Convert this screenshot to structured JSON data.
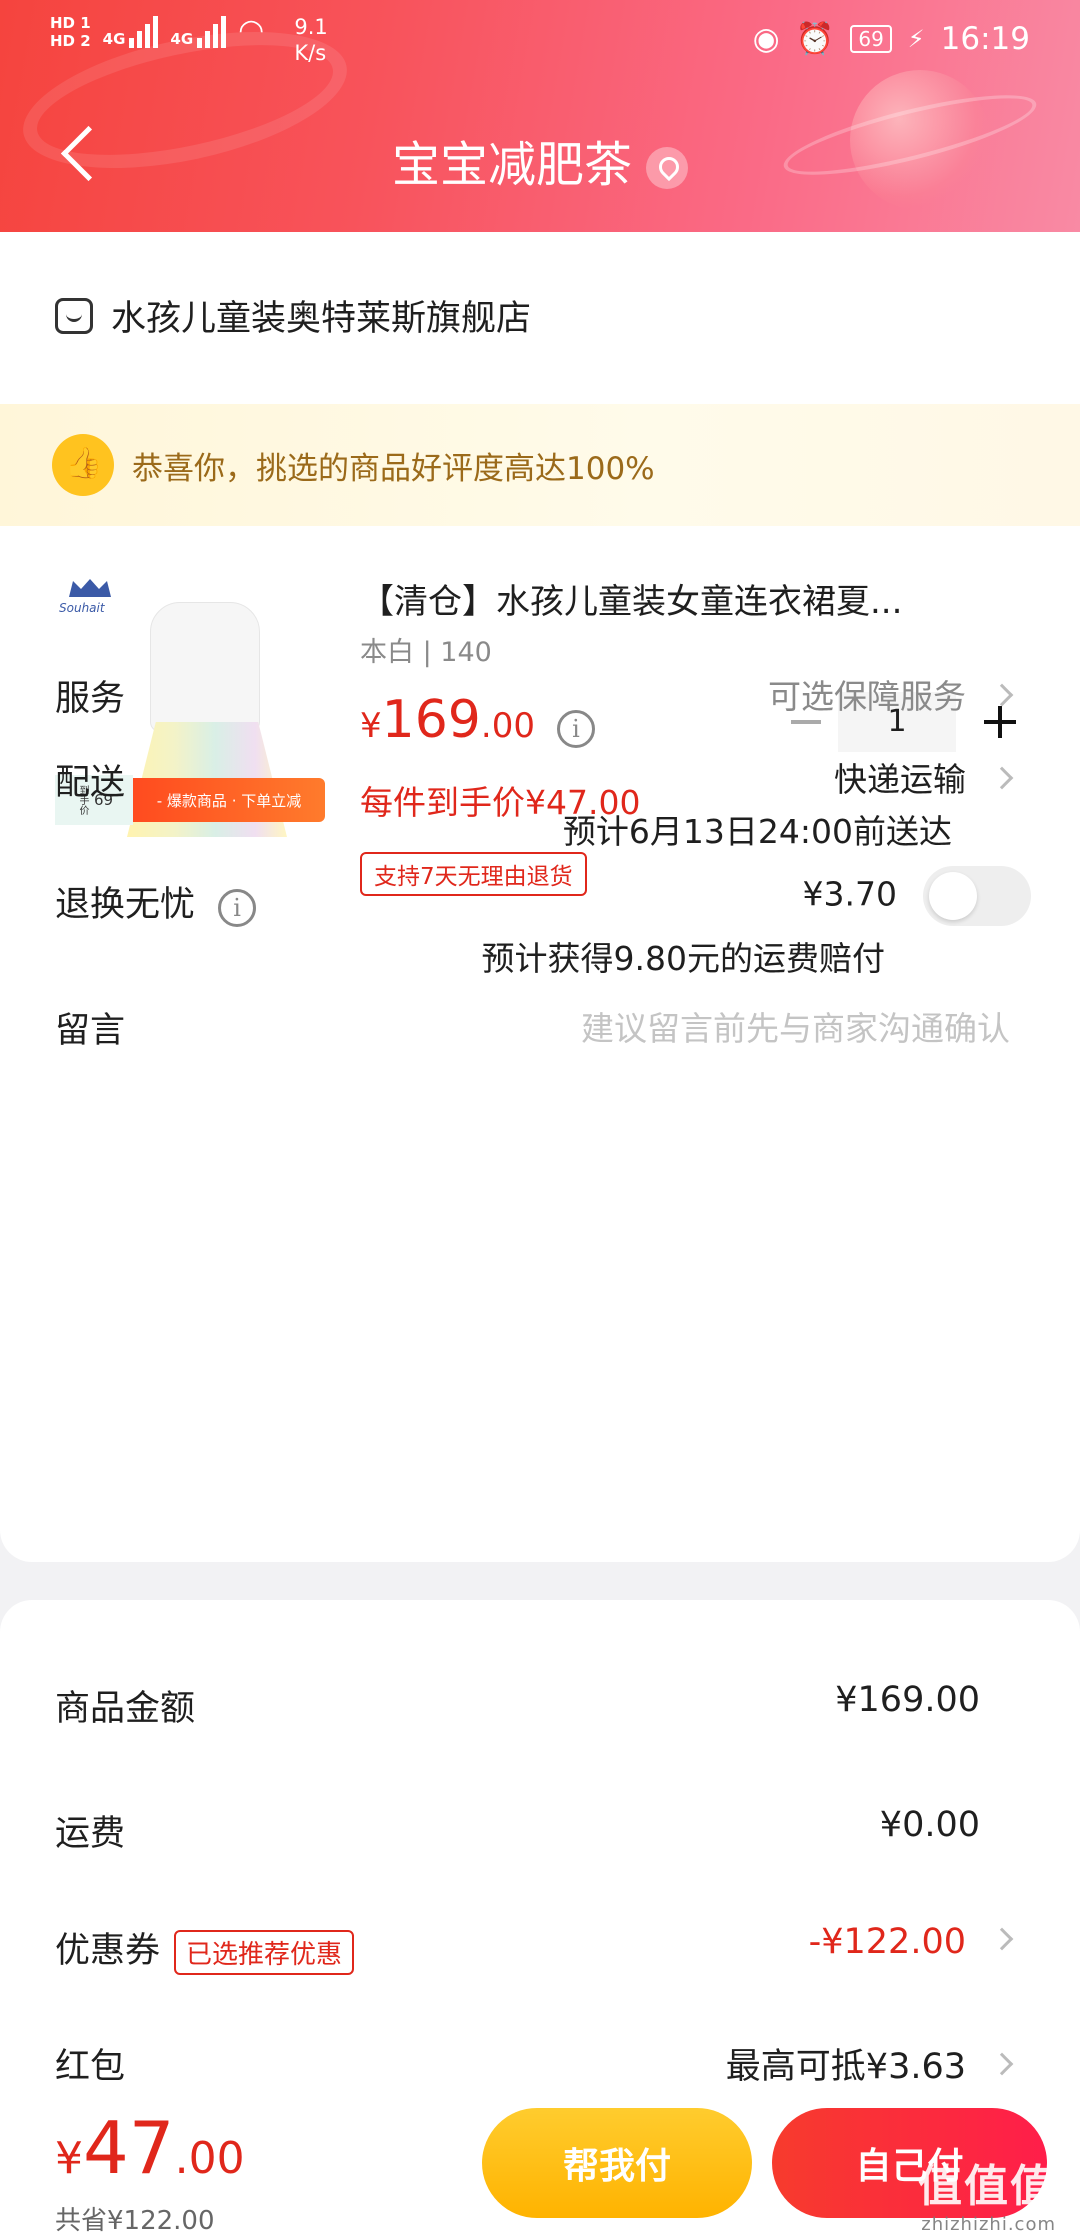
{
  "status_bar": {
    "hd1": "HD 1",
    "hd2": "HD 2",
    "net1": "4G",
    "net2": "4G",
    "speed_value": "9.1",
    "speed_unit": "K/s",
    "battery": "69",
    "time": "16:19"
  },
  "header": {
    "title": "宝宝减肥茶",
    "back_icon": "chevron-left-icon",
    "location_icon": "location-pin-icon"
  },
  "shop": {
    "name": "水孩儿童装奥特莱斯旗舰店"
  },
  "banner": {
    "text": "恭喜你，挑选的商品好评度高达100%"
  },
  "product": {
    "image_brand": "Souhait",
    "image_tag_left_num": "69",
    "image_tag_left_label": "到手价",
    "image_tag_right": "- 爆款商品 · 下单立减",
    "title": "【清仓】水孩儿童装女童连衣裙夏...",
    "spec": "本白 | 140",
    "price_currency": "¥",
    "price_int": "169",
    "price_dec": ".00",
    "quantity": "1",
    "unit_price": "每件到手价¥47.00",
    "return_badge": "支持7天无理由退货"
  },
  "rows": {
    "service_label": "服务",
    "service_value": "可选保障服务",
    "delivery_label": "配送",
    "delivery_value": "快递运输",
    "delivery_eta": "预计6月13日24:00前送达",
    "return_label": "退换无忧",
    "return_price": "¥3.70",
    "return_note": "预计获得9.80元的运费赔付",
    "message_label": "留言",
    "message_placeholder": "建议留言前先与商家沟通确认"
  },
  "summary": {
    "goods_label": "商品金额",
    "goods_value": "¥169.00",
    "shipping_label": "运费",
    "shipping_value": "¥0.00",
    "coupon_label": "优惠券",
    "coupon_tag": "已选推荐优惠",
    "coupon_value": "-¥122.00",
    "redpacket_label": "红包",
    "redpacket_value": "最高可抵¥3.63"
  },
  "bottom": {
    "total_currency": "¥",
    "total_int": "47",
    "total_dec": ".00",
    "saved": "共省¥122.00",
    "help_pay": "帮我付",
    "self_pay": "自己付"
  },
  "watermark": {
    "logo": "值值值",
    "url": "zhizhizhi.com"
  },
  "colors": {
    "accent_red": "#e0271b",
    "header_start": "#f5443e",
    "header_end": "#f98aa4",
    "help_button": "#ffb300",
    "self_button": "#f73b2d",
    "banner_bg": "#fff6d9"
  }
}
